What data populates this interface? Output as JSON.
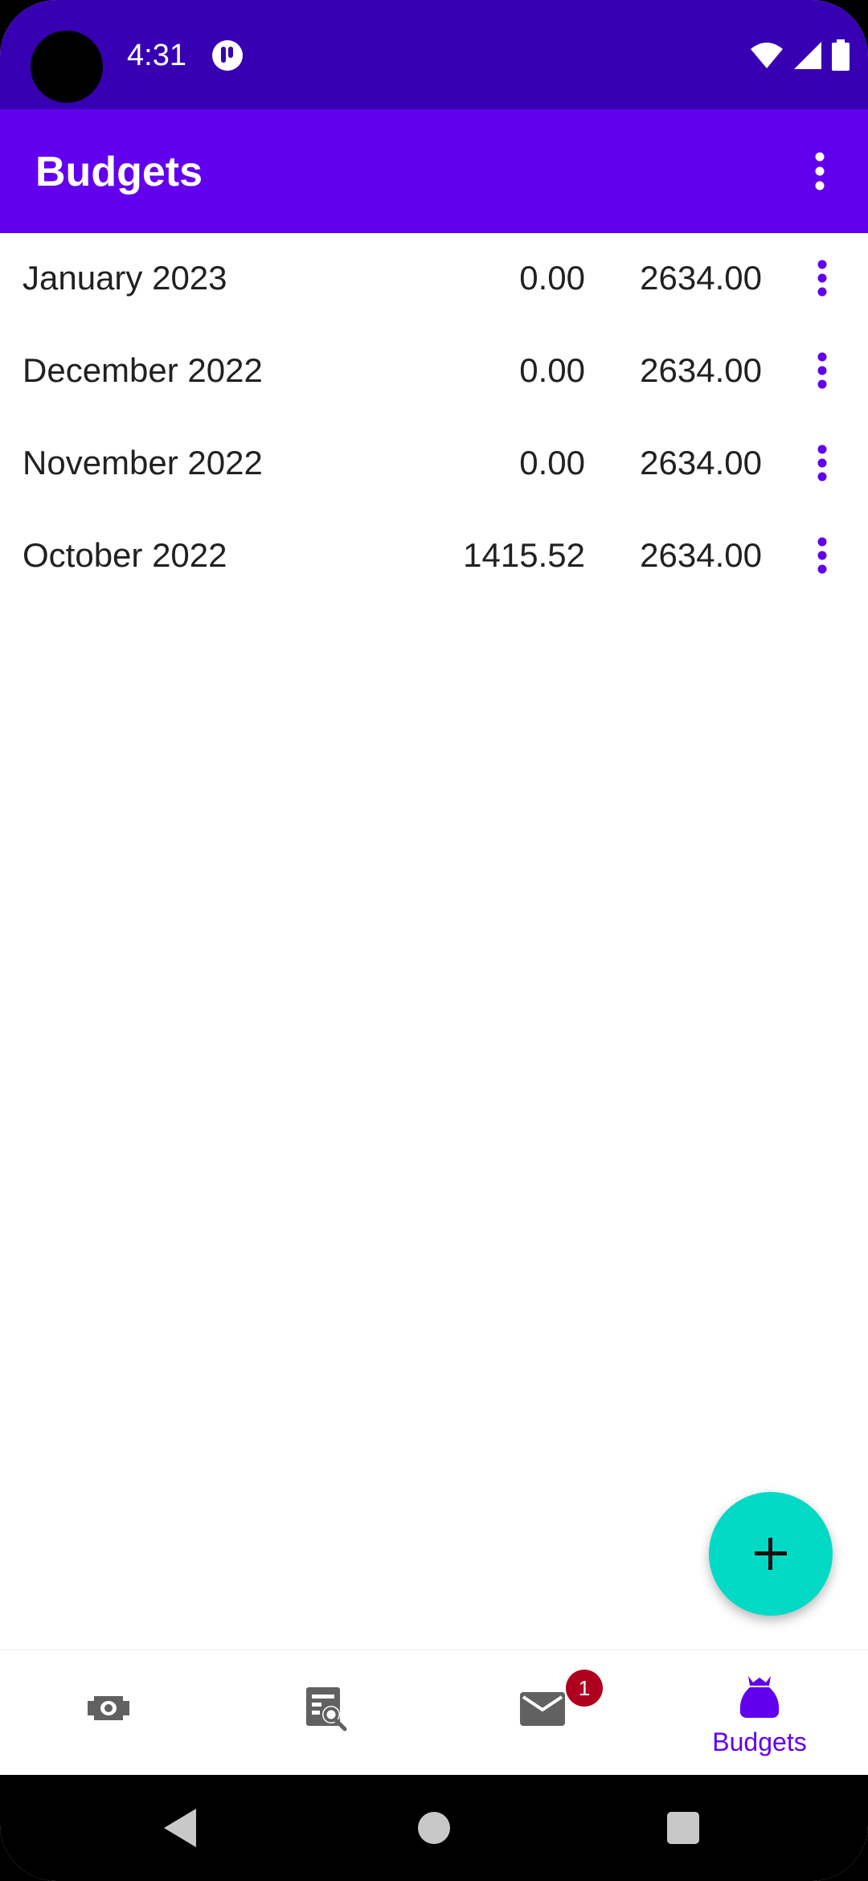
{
  "status_bar": {
    "time": "4:31"
  },
  "app_bar": {
    "title": "Budgets"
  },
  "budgets": [
    {
      "month": "January 2023",
      "spent": "0.00",
      "total": "2634.00"
    },
    {
      "month": "December 2022",
      "spent": "0.00",
      "total": "2634.00"
    },
    {
      "month": "November 2022",
      "spent": "0.00",
      "total": "2634.00"
    },
    {
      "month": "October 2022",
      "spent": "1415.52",
      "total": "2634.00"
    }
  ],
  "bottom_nav": {
    "items": [
      {
        "icon": "money-icon",
        "label": ""
      },
      {
        "icon": "search-list-icon",
        "label": ""
      },
      {
        "icon": "mail-icon",
        "label": "",
        "badge": "1"
      },
      {
        "icon": "budget-bag-icon",
        "label": "Budgets"
      }
    ]
  },
  "colors": {
    "primary": "#6200EE",
    "primary_dark": "#3700B3",
    "fab": "#03DAC5",
    "badge": "#B00020"
  }
}
